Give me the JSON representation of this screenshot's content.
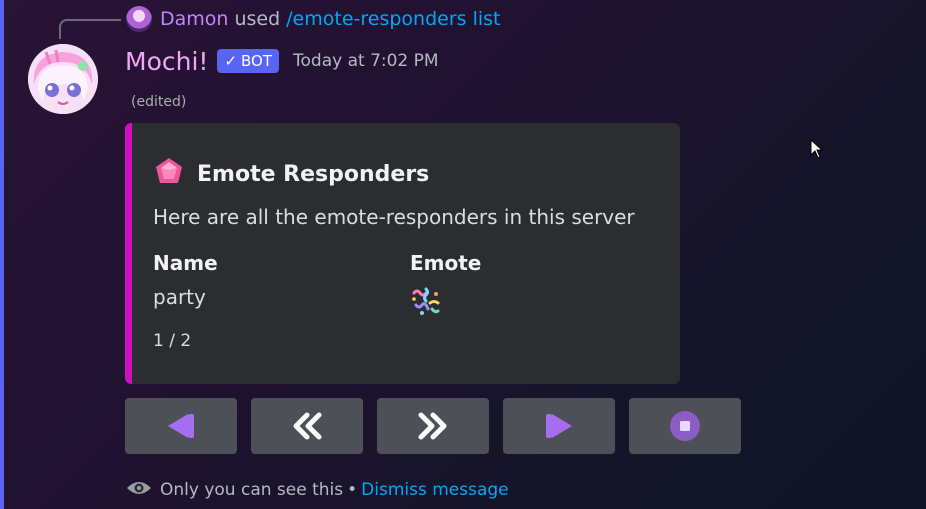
{
  "command": {
    "user": "Damon",
    "used_text": "used",
    "command": "/emote-responders list"
  },
  "message": {
    "username": "Mochi!",
    "badge": "BOT",
    "timestamp": "Today at 7:02 PM",
    "edited": "(edited)"
  },
  "embed": {
    "accent_color": "#d10ec0",
    "title": "Emote Responders",
    "description": "Here are all the emote-responders in this server",
    "fields": [
      {
        "name": "Name",
        "value": "party"
      },
      {
        "name": "Emote",
        "value_icon": "confetti-emote"
      }
    ],
    "footer": "1 / 2"
  },
  "buttons": [
    {
      "name": "first-page",
      "icon": "skip-back-icon"
    },
    {
      "name": "previous-page",
      "icon": "double-chevron-left-icon"
    },
    {
      "name": "next-page",
      "icon": "double-chevron-right-icon"
    },
    {
      "name": "last-page",
      "icon": "skip-forward-icon"
    },
    {
      "name": "stop",
      "icon": "stop-icon"
    }
  ],
  "ephemeral": {
    "text": "Only you can see this",
    "separator": "•",
    "dismiss": "Dismiss message"
  }
}
